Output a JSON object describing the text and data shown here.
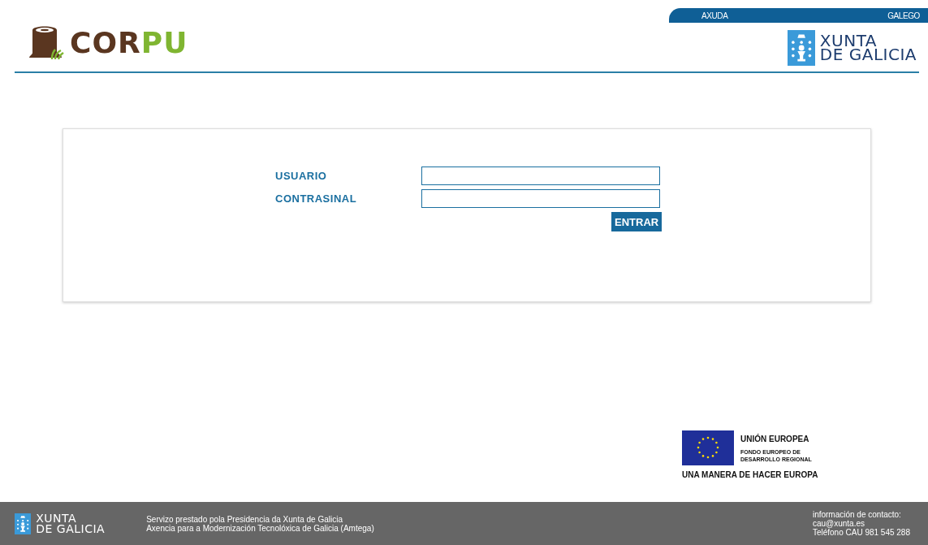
{
  "top_bar": {
    "links": [
      "AXUDA",
      "GALEGO"
    ]
  },
  "logo": {
    "first_part": "COR",
    "second_part": "PU"
  },
  "header_brand": {
    "line_1": "XUNTA",
    "line_2": "DE GALICIA"
  },
  "login_form": {
    "fields": [
      {
        "label": "USUARIO"
      },
      {
        "label": "CONTRASINAL"
      }
    ],
    "submit": "ENTRAR"
  },
  "eu_block": {
    "title": "UNIÓN EUROPEA",
    "fund_line_1": "FONDO EUROPEO DE",
    "fund_line_2": "DESARROLLO REGIONAL",
    "motto": "UNA MANERA DE HACER EUROPA"
  },
  "footer": {
    "brand": {
      "line_1": "XUNTA",
      "line_2": "DE GALICIA"
    },
    "service_lines": [
      "Servizo prestado pola Presidencia da Xunta de Galicia",
      "Axencia para a Modernización Tecnolóxica de Galicia (Amtega)"
    ],
    "contact_lines": [
      "información de contacto:",
      "cau@xunta.es",
      "Teléfono CAU 981 545 288"
    ]
  }
}
